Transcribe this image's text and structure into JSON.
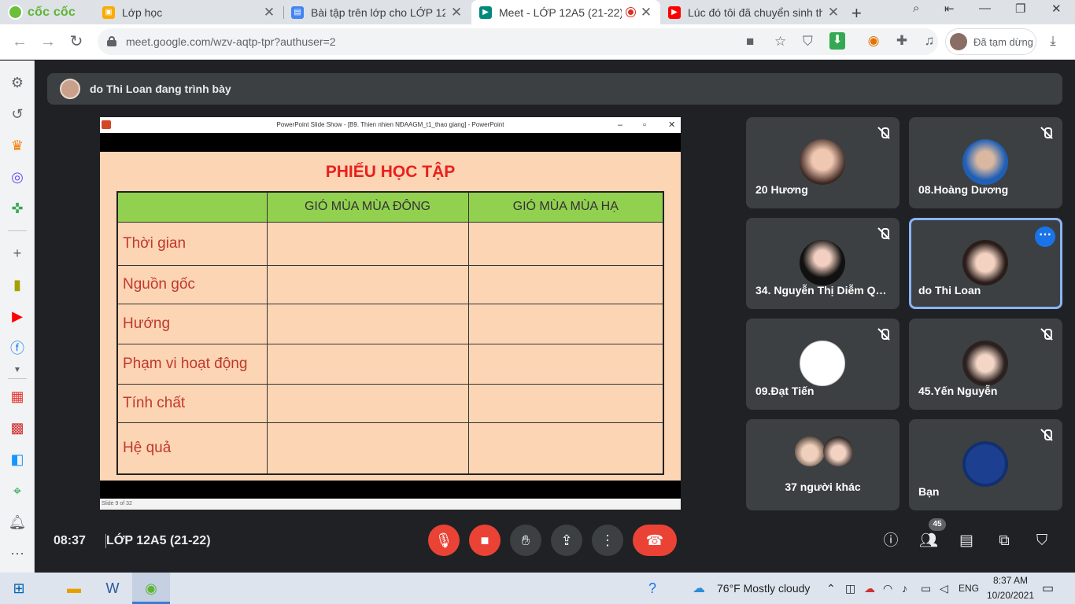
{
  "browser": {
    "brand": "cốc cốc",
    "tabs": [
      {
        "title": "Lớp học",
        "close": "✕"
      },
      {
        "title": "Bài tập trên lớp cho LỚP 12A",
        "close": "✕"
      },
      {
        "title": "Meet - LỚP 12A5 (21-22)",
        "close": "✕"
      },
      {
        "title": "Lúc đó tôi đã chuyển sinh thà",
        "close": "✕"
      }
    ],
    "url": "meet.google.com/wzv-aqtp-tpr?authuser=2",
    "profile_status": "Đã tạm dừng"
  },
  "banner": {
    "text": "do Thi Loan đang trình bày"
  },
  "presentation": {
    "window_title": "PowerPoint Slide Show - [B9. Thien nhien NĐAAGM_t1_thao giang] - PowerPoint",
    "heading": "PHIẾU HỌC TẬP",
    "columns": [
      "",
      "GIÓ MÙA MÙA ĐÔNG",
      "GIÓ MÙA MÙA HẠ"
    ],
    "rows": [
      "Thời gian",
      "Nguồn gốc",
      "Hướng",
      "Phạm vi hoạt động",
      "Tính chất",
      "Hệ quả"
    ],
    "status": "Slide 9 of 32"
  },
  "participants": [
    {
      "name": "20 Hương",
      "muted": true
    },
    {
      "name": "08.Hoàng Dương",
      "muted": true
    },
    {
      "name": "34. Nguyễn Thị Diễm Qu…",
      "muted": true
    },
    {
      "name": "do Thi Loan",
      "muted": false
    },
    {
      "name": "09.Đạt Tiến",
      "muted": true
    },
    {
      "name": "45.Yến Nguyễn",
      "muted": true
    },
    {
      "name": "37 người khác",
      "muted": false
    },
    {
      "name": "Bạn",
      "muted": true
    }
  ],
  "meeting": {
    "time": "08:37",
    "name": "LỚP 12A5 (21-22)",
    "people_count": "45"
  },
  "taskbar": {
    "weather": "76°F  Mostly cloudy",
    "lang": "ENG",
    "time": "8:37 AM",
    "date": "10/20/2021"
  }
}
